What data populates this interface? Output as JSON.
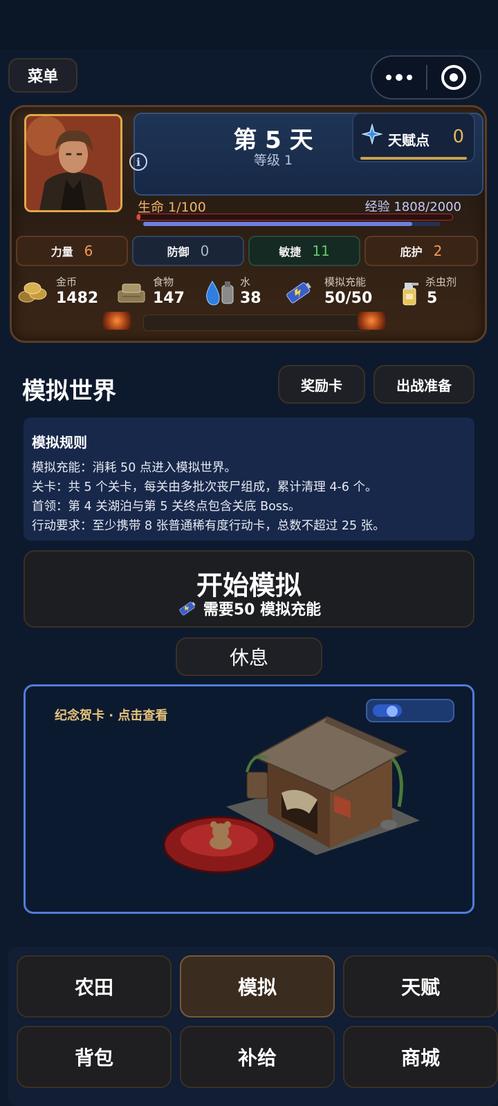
{
  "topbar": {
    "menu_label": "菜单"
  },
  "status": {
    "day_title": "第 5 天",
    "level": "等级 1",
    "talent": {
      "label": "天赋点",
      "value": "0"
    },
    "hp": {
      "label": "生命 1/100",
      "fraction": 0.01
    },
    "exp": {
      "label": "经验 1808/2000",
      "fraction": 0.904
    },
    "stats": [
      {
        "label": "力量",
        "value": "6"
      },
      {
        "label": "防御",
        "value": "0"
      },
      {
        "label": "敏捷",
        "value": "11"
      },
      {
        "label": "庇护",
        "value": "2"
      }
    ],
    "resources": [
      {
        "label": "金币",
        "value": "1482",
        "icon": "coins-icon"
      },
      {
        "label": "食物",
        "value": "147",
        "icon": "food-icon"
      },
      {
        "label": "水",
        "value": "38",
        "icon": "water-icon"
      },
      {
        "label": "模拟充能",
        "value": "50/50",
        "icon": "battery-icon"
      },
      {
        "label": "杀虫剂",
        "value": "5",
        "icon": "spray-icon"
      }
    ]
  },
  "world": {
    "title": "模拟世界",
    "reward_button": "奖励卡",
    "prepare_button": "出战准备",
    "rules": {
      "title": "模拟规则",
      "lines": [
        "模拟充能：消耗 50 点进入模拟世界。",
        "关卡：共 5 个关卡，每关由多批次丧尸组成，累计清理 4-6 个。",
        "首领：第 4 关湖泊与第 5 关终点包含关底 Boss。",
        "行动要求：至少携带 8 张普通稀有度行动卡，总数不超过 25 张。"
      ]
    },
    "start_button": {
      "title": "开始模拟",
      "subtitle": "需要50 模拟充能"
    },
    "rest_button": "休息",
    "card": {
      "label": "纪念贺卡 · 点击查看"
    }
  },
  "nav": [
    {
      "label": "农田",
      "active": false
    },
    {
      "label": "模拟",
      "active": true
    },
    {
      "label": "天赋",
      "active": false
    },
    {
      "label": "背包",
      "active": false
    },
    {
      "label": "补给",
      "active": false
    },
    {
      "label": "商城",
      "active": false
    }
  ]
}
